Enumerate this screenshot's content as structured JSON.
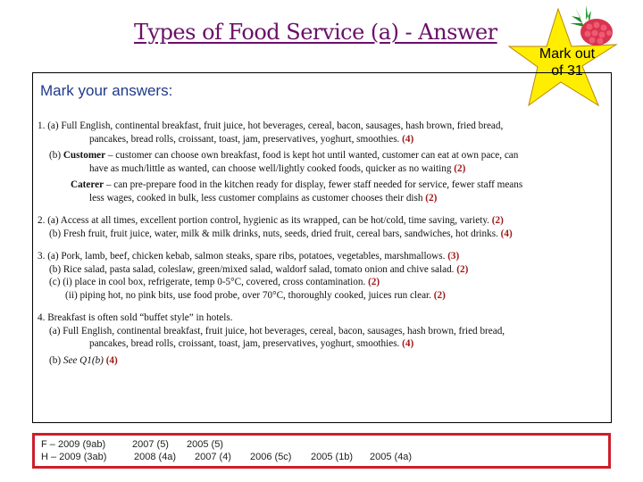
{
  "header": {
    "title": "Types of Food Service (a) - Answer",
    "badge": {
      "line1": "Mark out",
      "line2": "of 31",
      "icon": "raspberry-icon"
    }
  },
  "main": {
    "subtitle": "Mark your answers:",
    "q1": {
      "a_line1": "1. (a) Full English, continental breakfast, fruit juice, hot beverages, cereal, bacon, sausages, hash brown, fried bread,",
      "a_line2": "pancakes, bread rolls, croissant, toast, jam, preservatives, yoghurt, smoothies.",
      "a_mark": "(4)",
      "b_label": "(b) ",
      "b_bold": "Customer",
      "b_line1": " – customer can choose own breakfast, food is kept hot until wanted, customer can eat at own pace, can",
      "b_line2": "have as much/little as wanted, can choose well/lightly cooked foods, quicker as no waiting",
      "b_mark": "(2)",
      "c_bold": "Caterer",
      "c_line1": " – can pre-prepare food in the kitchen ready for display, fewer staff needed for service, fewer staff means",
      "c_line2": "less wages, cooked in bulk, less customer complains as customer chooses their dish",
      "c_mark": "(2)"
    },
    "q2": {
      "a_line": "2. (a) Access at all times, excellent portion control, hygienic as its wrapped, can be hot/cold, time saving, variety.",
      "a_mark": "(2)",
      "b_line": "(b) Fresh fruit, fruit juice, water, milk & milk drinks, nuts, seeds, dried fruit, cereal bars, sandwiches, hot drinks.",
      "b_mark": "(4)"
    },
    "q3": {
      "a_line": "3. (a) Pork, lamb, beef, chicken kebab, salmon steaks, spare ribs, potatoes, vegetables, marshmallows.",
      "a_mark": "(3)",
      "b_line": "(b) Rice salad, pasta salad, coleslaw, green/mixed salad, waldorf salad, tomato onion and chive salad.",
      "b_mark": "(2)",
      "c_line": "(c) (i) place in cool box, refrigerate, temp 0-5°C, covered, cross contamination.",
      "c_mark": "(2)",
      "d_line": "(ii) piping hot, no pink bits, use food probe, over 70°C, thoroughly cooked, juices run clear.",
      "d_mark": "(2)"
    },
    "q4": {
      "intro": "4. Breakfast is often sold “buffet style” in hotels.",
      "a_line1": "(a) Full English, continental breakfast, fruit juice, hot beverages, cereal, bacon, sausages, hash brown, fried bread,",
      "a_line2": "pancakes, bread rolls, croissant, toast, jam, preservatives, yoghurt, smoothies.",
      "a_mark": "(4)",
      "b_label": "(b) ",
      "b_ital": "See Q1(b)",
      "b_mark": "(4)"
    }
  },
  "references": {
    "foundation": [
      "F – 2009 (9ab)",
      "2007 (5)",
      "2005 (5)"
    ],
    "higher": [
      "H – 2009 (3ab)",
      "2008 (4a)",
      "2007 (4)",
      "2006 (5c)",
      "2005 (1b)",
      "2005 (4a)"
    ]
  },
  "colors": {
    "title": "#6a0f6a",
    "subtitle": "#1f3a8a",
    "marks": "#a01818",
    "ref_border": "#cc1f2b",
    "star_fill": "#ffee00"
  }
}
